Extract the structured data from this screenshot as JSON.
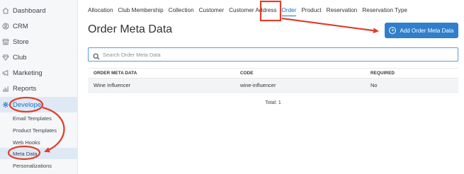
{
  "sidebar": {
    "items": [
      {
        "label": "Dashboard",
        "icon": "home-icon"
      },
      {
        "label": "CRM",
        "icon": "user-circle-icon"
      },
      {
        "label": "Store",
        "icon": "store-icon"
      },
      {
        "label": "Club",
        "icon": "diamond-icon"
      },
      {
        "label": "Marketing",
        "icon": "megaphone-icon"
      },
      {
        "label": "Reports",
        "icon": "bar-chart-icon"
      },
      {
        "label": "Developer",
        "icon": "gear-icon"
      }
    ],
    "sub_items": [
      {
        "label": "Email Templates"
      },
      {
        "label": "Product Templates"
      },
      {
        "label": "Web Hooks"
      },
      {
        "label": "Meta Data"
      },
      {
        "label": "Personalizations"
      }
    ]
  },
  "tabs": [
    "Allocation",
    "Club Membership",
    "Collection",
    "Customer",
    "Customer Address",
    "Order",
    "Product",
    "Reservation",
    "Reservation Type"
  ],
  "page": {
    "title": "Order Meta Data",
    "add_button": "Add Order Meta Data",
    "search_placeholder": "Search Order Meta Data"
  },
  "table": {
    "headers": [
      "ORDER META DATA",
      "CODE",
      "REQUIRED"
    ],
    "rows": [
      [
        "Wine Influencer",
        "wine-influencer",
        "No"
      ]
    ]
  },
  "total_label": "Total: 1",
  "colors": {
    "accent": "#2f7fcc",
    "annotation": "#e0402a",
    "active_bg": "#dfe9f6"
  }
}
